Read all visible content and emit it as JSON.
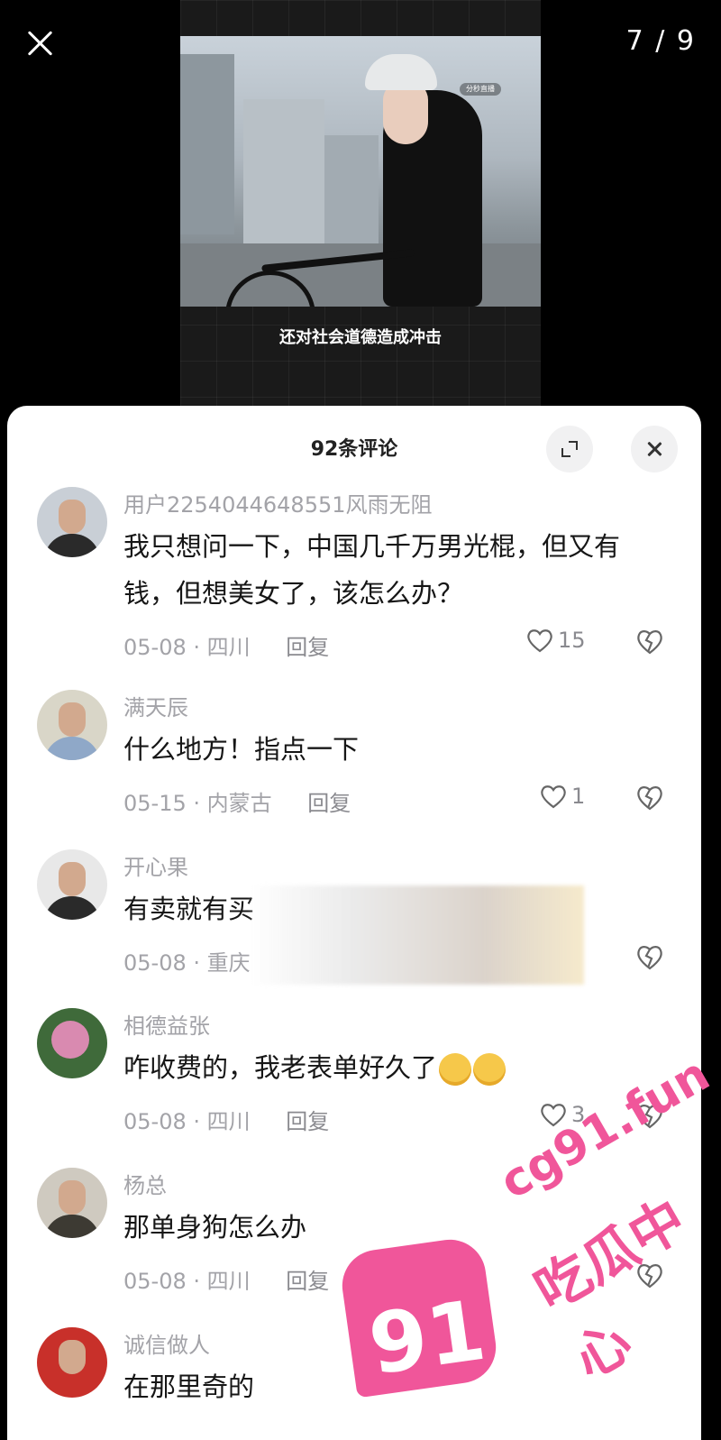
{
  "viewer": {
    "page_counter": "7 / 9",
    "video_badge": "分秒直播",
    "video_caption": "还对社会道德造成冲击"
  },
  "sheet": {
    "title": "92条评论"
  },
  "comments": [
    {
      "username": "用户2254044648551风雨无阻",
      "text": "我只想问一下，中国几千万男光棍，但又有钱，但想美女了，该怎么办？",
      "meta": "05-08 · 四川",
      "reply": "回复",
      "likes": "15"
    },
    {
      "username": "满天辰",
      "text": "什么地方！指点一下",
      "meta": "05-15 · 内蒙古",
      "reply": "回复",
      "likes": "1"
    },
    {
      "username": "开心果",
      "text": "有卖就有买",
      "meta": "05-08 · 重庆",
      "reply": "",
      "likes": ""
    },
    {
      "username": "相德益张",
      "text": "咋收费的，我老表单好久了",
      "meta": "05-08 · 四川",
      "reply": "回复",
      "likes": "3"
    },
    {
      "username": "杨总",
      "text": "那单身狗怎么办",
      "meta": "05-08 · 四川",
      "reply": "回复",
      "likes": ""
    },
    {
      "username": "诚信做人",
      "text": "在那里奇的",
      "meta": "",
      "reply": "",
      "likes": ""
    }
  ],
  "watermark": {
    "number": "91",
    "url": "cg91.fun",
    "name": "吃瓜中心"
  },
  "colors": {
    "accent": "#f0569a",
    "meta_text": "#a3a3a8"
  }
}
